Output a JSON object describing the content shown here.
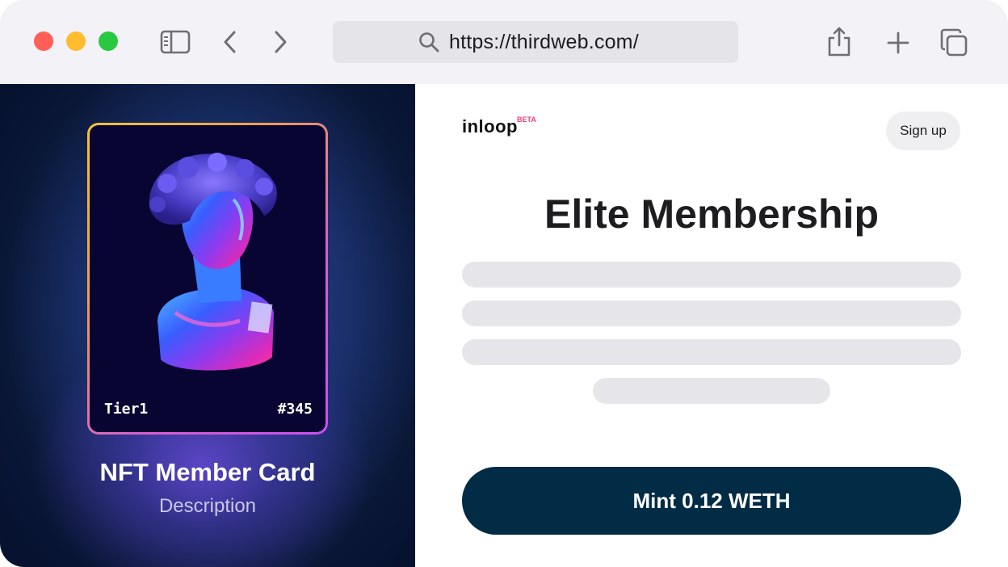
{
  "browser": {
    "url": "https://thirdweb.com/",
    "icons": [
      "sidebar-icon",
      "back-icon",
      "forward-icon",
      "search-icon",
      "share-icon",
      "new-tab-icon",
      "tabs-overview-icon"
    ]
  },
  "hero": {
    "card": {
      "tier": "Tier1",
      "serial": "#345"
    },
    "title": "NFT Member Card",
    "description": "Description"
  },
  "panel": {
    "logo": {
      "text": "inloop",
      "badge": "BETA"
    },
    "signup_label": "Sign up",
    "heading": "Elite Membership",
    "mint_label": "Mint 0.12 WETH"
  },
  "colors": {
    "mint_button": "#022b46",
    "traffic_red": "#ff5f57",
    "traffic_yellow": "#febc2e",
    "traffic_green": "#28c840",
    "beta_badge": "#f0437a"
  }
}
